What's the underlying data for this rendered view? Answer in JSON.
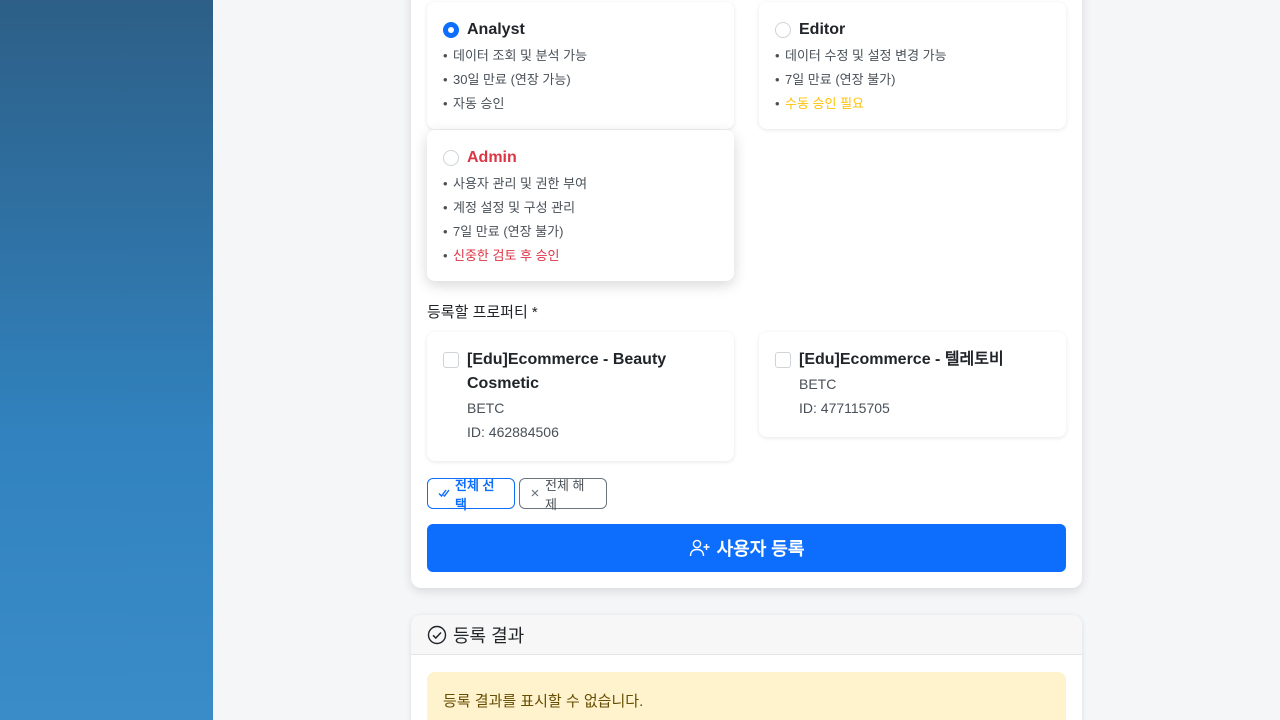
{
  "roles": [
    {
      "title": "Analyst",
      "checked": true,
      "bullets": [
        {
          "text": "데이터 조회 및 분석 가능",
          "tone": "normal"
        },
        {
          "text": "30일 만료 (연장 가능)",
          "tone": "normal"
        },
        {
          "text": "자동 승인",
          "tone": "normal"
        }
      ]
    },
    {
      "title": "Editor",
      "checked": false,
      "bullets": [
        {
          "text": "데이터 수정 및 설정 변경 가능",
          "tone": "normal"
        },
        {
          "text": "7일 만료 (연장 불가)",
          "tone": "normal"
        },
        {
          "text": "수동 승인 필요",
          "tone": "warning"
        }
      ]
    },
    {
      "title": "Admin",
      "checked": false,
      "bullets": [
        {
          "text": "사용자 관리 및 권한 부여",
          "tone": "normal"
        },
        {
          "text": "계정 설정 및 구성 관리",
          "tone": "normal"
        },
        {
          "text": "7일 만료 (연장 불가)",
          "tone": "normal"
        },
        {
          "text": "신중한 검토 후 승인",
          "tone": "danger"
        }
      ]
    }
  ],
  "properties_section": {
    "label": "등록할 프로퍼티 *",
    "items": [
      {
        "name_line1": "[Edu]Ecommerce - Beauty",
        "name_line2": "Cosmetic",
        "code": "BETC",
        "id": "ID: 462884506",
        "checked": false
      },
      {
        "name_line1": "[Edu]Ecommerce - 텔레토비",
        "name_line2": "",
        "code": "BETC",
        "id": "ID: 477115705",
        "checked": false
      }
    ],
    "select_all_label": "전체 선택",
    "deselect_all_label": "전체 해제",
    "submit_label": "사용자 등록"
  },
  "result": {
    "title": "등록 결과",
    "message": "등록 결과를 표시할 수 없습니다."
  },
  "colors": {
    "primary": "#0d6efd",
    "danger": "#dc3545",
    "warning": "#ffc107",
    "alert_bg": "#fff3cd"
  },
  "icons": {
    "select_all": "check-double-icon",
    "deselect_all": "x-icon",
    "submit": "user-plus-icon",
    "result": "check-circle-icon"
  }
}
